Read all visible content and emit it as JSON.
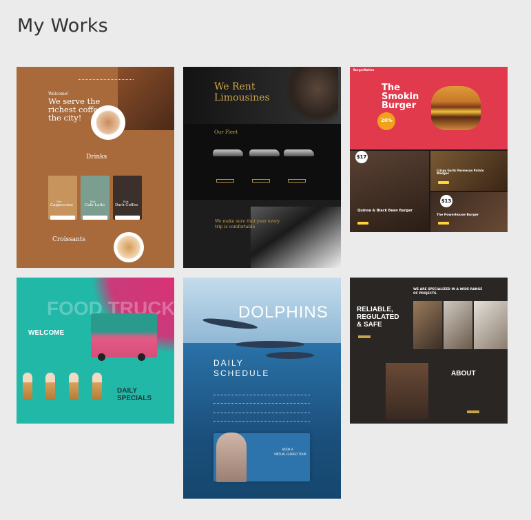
{
  "page": {
    "title": "My Works"
  },
  "works": [
    {
      "id": "coffee",
      "welcome": "Welcome!",
      "headline_1": "We serve the",
      "headline_2": "richest coffee in",
      "headline_3": "the city!",
      "section": "Drinks",
      "items": [
        {
          "kicker": "Hot",
          "name": "Cappuccino"
        },
        {
          "kicker": "Hot",
          "name": "Cafe Latte"
        },
        {
          "kicker": "Hot",
          "name": "Dark Coffee"
        }
      ],
      "section2": "Croissants"
    },
    {
      "id": "limousines",
      "headline_1": "We Rent",
      "headline_2": "Limousines",
      "fleet": "Our Fleet",
      "tagline_1": "We make sure that your every",
      "tagline_2": "trip is comfortable"
    },
    {
      "id": "burger",
      "brand": "BurgerNation",
      "headline_1": "The",
      "headline_2": "Smokin",
      "headline_3": "Burger",
      "discount": "20%",
      "price_1": "$17",
      "item_1": "Quinoa & Black Bean Burger",
      "item_2": "Crispy Garlic Parmesan Potato Wedges",
      "price_2": "$13",
      "item_3": "The Powerhouse Burger"
    },
    {
      "id": "food-truck",
      "headline": "FOOD TRUCK",
      "welcome": "WELCOME",
      "special_1": "DAILY",
      "special_2": "SPECIALS"
    },
    {
      "id": "dolphins",
      "headline": "DOLPHINS",
      "schedule_1": "DAILY",
      "schedule_2": "SCHEDULE",
      "tour_1": "BOOK A",
      "tour_2": "VIRTUAL GUIDED TOUR"
    },
    {
      "id": "construction",
      "intro_1": "WE ARE SPECIALIZED IN A WIDE-RANGE",
      "intro_2": "OF PROJECTS.",
      "headline_1": "RELIABLE,",
      "headline_2": "REGULATED",
      "headline_3": "& SAFE",
      "about": "ABOUT"
    }
  ]
}
